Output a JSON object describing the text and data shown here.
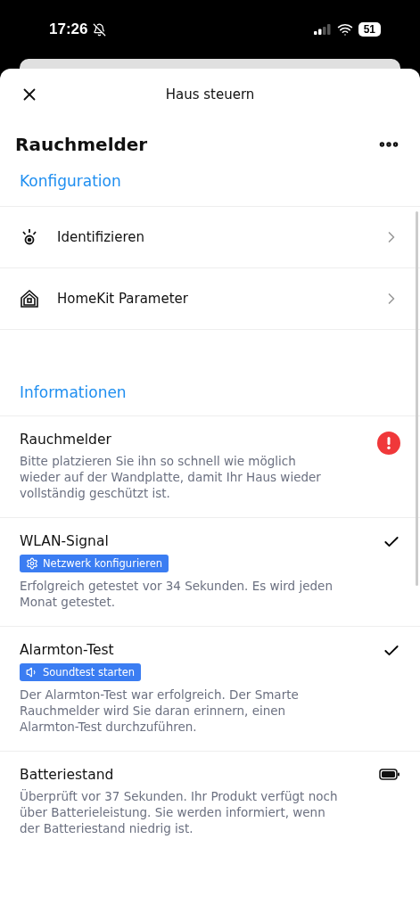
{
  "status_bar": {
    "time": "17:26",
    "battery": "51"
  },
  "header": {
    "title": "Haus steuern"
  },
  "device": {
    "name": "Rauchmelder"
  },
  "config": {
    "heading": "Konfiguration",
    "items": [
      {
        "kind": "identify",
        "label": "Identifizieren"
      },
      {
        "kind": "homekit",
        "label": "HomeKit Parameter"
      }
    ]
  },
  "info": {
    "heading": "Informationen",
    "items": [
      {
        "kind": "error",
        "title": "Rauchmelder",
        "text": "Bitte platzieren Sie ihn so schnell wie möglich wieder auf der Wandplatte, damit Ihr Haus wieder vollständig geschützt ist."
      },
      {
        "kind": "ok",
        "title": "WLAN-Signal",
        "action": {
          "kind": "network",
          "label": "Netzwerk konfigurieren"
        },
        "text": "Erfolgreich getestet vor 34 Sekunden. Es wird jeden Monat getestet."
      },
      {
        "kind": "ok",
        "title": "Alarmton-Test",
        "action": {
          "kind": "sound",
          "label": "Soundtest starten"
        },
        "text": "Der Alarmton-Test war erfolgreich. Der Smarte Rauchmelder wird Sie daran erinnern, einen Alarmton-Test durchzuführen."
      },
      {
        "kind": "battery",
        "title": "Batteriestand",
        "text": "Überprüft vor 37 Sekunden. Ihr Produkt verfügt noch über Batterieleistung. Sie werden informiert, wenn der Batteriestand niedrig ist."
      }
    ]
  }
}
